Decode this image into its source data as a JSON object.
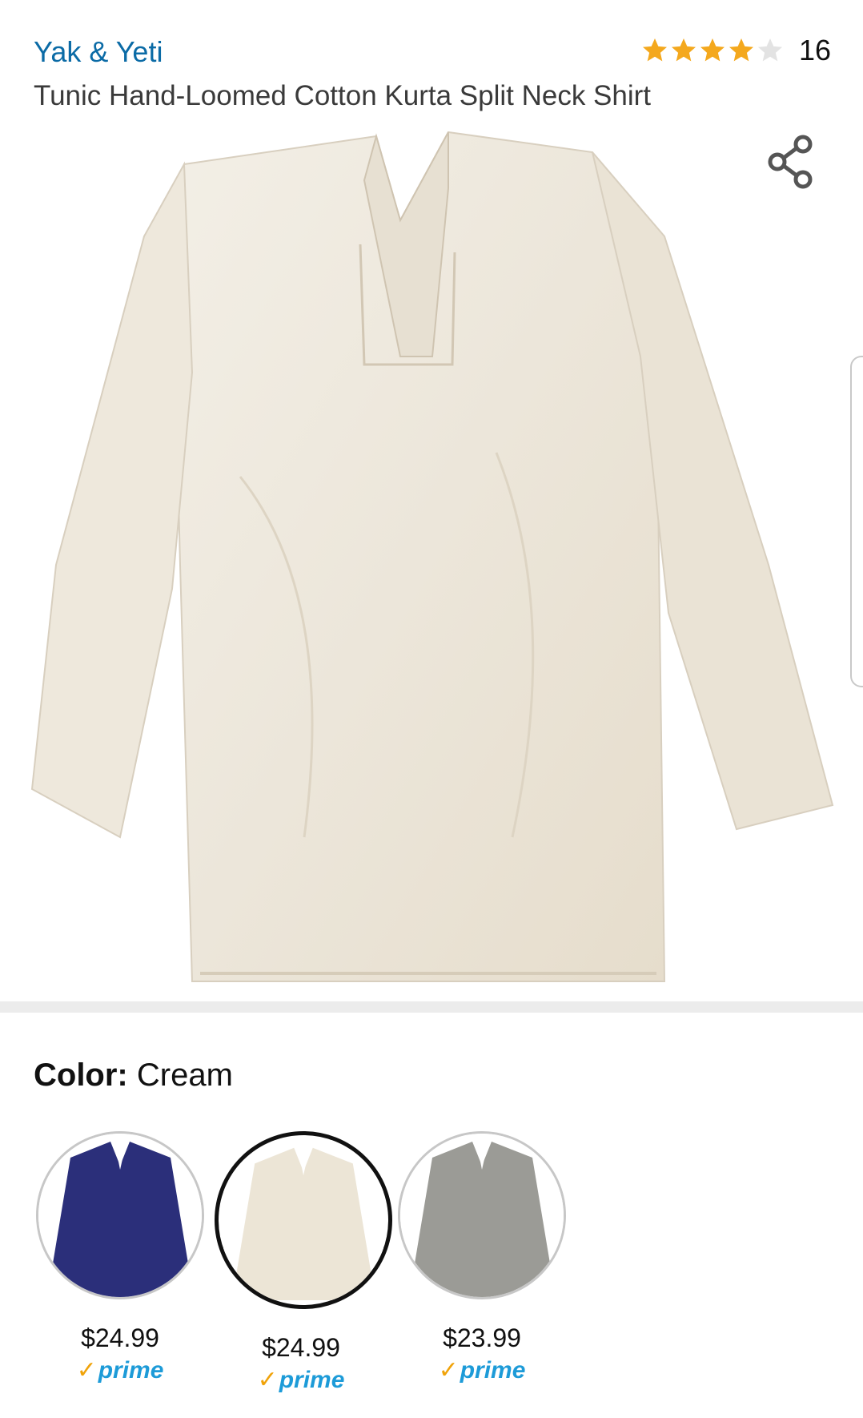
{
  "header": {
    "brand": "Yak & Yeti",
    "rating_value": 4,
    "rating_max": 5,
    "rating_count": "16",
    "title": "Tunic Hand-Loomed Cotton Kurta Split Neck Shirt"
  },
  "colors": {
    "brand_link": "#0b6ba6",
    "star": "#f4a81d",
    "prime": "#1d9bd8"
  },
  "color_selector": {
    "label": "Color:",
    "selected": "Cream"
  },
  "swatches": [
    {
      "name": "Navy",
      "price": "$24.99",
      "badge": "prime",
      "selected": false
    },
    {
      "name": "Cream",
      "price": "$24.99",
      "badge": "prime",
      "selected": true
    },
    {
      "name": "Gray",
      "price": "$23.99",
      "badge": "prime",
      "selected": false
    }
  ],
  "icons": {
    "share": "share-icon",
    "prime_check": "check-icon"
  }
}
